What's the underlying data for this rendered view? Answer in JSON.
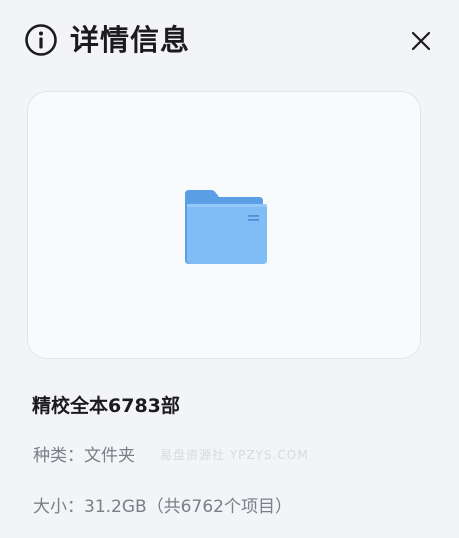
{
  "header": {
    "title": "详情信息",
    "info_icon": "info-circle-icon",
    "close_icon": "close-icon"
  },
  "preview": {
    "icon": "folder-icon",
    "folder_color": "#6aaef0"
  },
  "details": {
    "name": "精校全本6783部",
    "kind_label": "种类：",
    "kind_value": "文件夹",
    "size_label": "大小：",
    "size_value": "31.2GB（共6762个项目）"
  },
  "watermark": "易盘资源社 YPZYS.COM"
}
